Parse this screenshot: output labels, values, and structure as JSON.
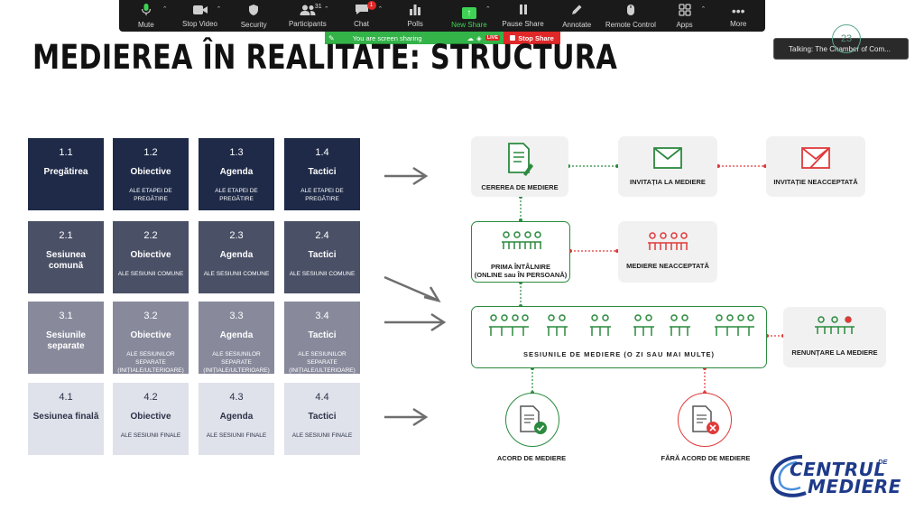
{
  "zoom": {
    "toolbar": [
      {
        "label": "Mute",
        "icon": "microphone-icon"
      },
      {
        "label": "Stop Video",
        "icon": "video-camera-icon"
      },
      {
        "label": "Security",
        "icon": "shield-icon"
      },
      {
        "label": "Participants",
        "icon": "participants-icon",
        "count": "31"
      },
      {
        "label": "Chat",
        "icon": "chat-icon",
        "badge": "1"
      },
      {
        "label": "Polls",
        "icon": "polls-icon"
      },
      {
        "label": "New Share",
        "icon": "share-screen-icon"
      },
      {
        "label": "Pause Share",
        "icon": "pause-icon"
      },
      {
        "label": "Annotate",
        "icon": "pencil-icon"
      },
      {
        "label": "Remote Control",
        "icon": "mouse-icon"
      },
      {
        "label": "Apps",
        "icon": "apps-icon"
      },
      {
        "label": "More",
        "icon": "more-icon"
      }
    ],
    "share_banner": "You are screen sharing",
    "live_badge": "LIVE",
    "stop_share": "Stop Share",
    "talking": "Talking: The Chamber of Com...",
    "accent_color": "#3fd254",
    "stop_color": "#e02828"
  },
  "slide": {
    "number": "23",
    "title": "MEDIEREA ÎN REALITATE: STRUCTURA",
    "grid": [
      [
        {
          "num": "1.1",
          "title": "Pregătirea",
          "sub": ""
        },
        {
          "num": "1.2",
          "title": "Obiective",
          "sub": "ale etapei de pregătire"
        },
        {
          "num": "1.3",
          "title": "Agenda",
          "sub": "ale etapei de pregătire"
        },
        {
          "num": "1.4",
          "title": "Tactici",
          "sub": "ale etapei de pregătire"
        }
      ],
      [
        {
          "num": "2.1",
          "title": "Sesiunea comună",
          "sub": ""
        },
        {
          "num": "2.2",
          "title": "Obiective",
          "sub": "ale sesiunii comune"
        },
        {
          "num": "2.3",
          "title": "Agenda",
          "sub": "ale sesiunii comune"
        },
        {
          "num": "2.4",
          "title": "Tactici",
          "sub": "ale sesiunii comune"
        }
      ],
      [
        {
          "num": "3.1",
          "title": "Sesiunile separate",
          "sub": ""
        },
        {
          "num": "3.2",
          "title": "Obiective",
          "sub": "ale sesiunilor separate (inițiale/ulterioare)"
        },
        {
          "num": "3.3",
          "title": "Agenda",
          "sub": "ale sesiunilor separate (inițiale/ulterioare)"
        },
        {
          "num": "3.4",
          "title": "Tactici",
          "sub": "ale sesiunilor separate (inițiale/ulterioare)"
        }
      ],
      [
        {
          "num": "4.1",
          "title": "Sesiunea finală",
          "sub": ""
        },
        {
          "num": "4.2",
          "title": "Obiective",
          "sub": "ale sesiunii finale"
        },
        {
          "num": "4.3",
          "title": "Agenda",
          "sub": "ale sesiunii finale"
        },
        {
          "num": "4.4",
          "title": "Tactici",
          "sub": "ale sesiunii finale"
        }
      ]
    ],
    "flow": {
      "request": "CEREREA DE MEDIERE",
      "invitation": "INVITAȚIA LA MEDIERE",
      "invitation_refused": "INVITAȚIE NEACCEPTATĂ",
      "first_meeting_l1": "PRIMA ÎNTÂLNIRE",
      "first_meeting_l2": "(ONLINE sau ÎN PERSOANĂ)",
      "mediation_refused": "MEDIERE NEACCEPTATĂ",
      "sessions": "SESIUNILE  DE  MEDIERE (O ZI SAU MAI MULTE)",
      "withdraw": "RENUNȚARE LA MEDIERE",
      "agreement": "ACORD DE MEDIERE",
      "no_agreement": "FĂRĂ ACORD DE MEDIERE",
      "colors": {
        "green": "#2b8a3e",
        "red": "#e03a3a"
      }
    },
    "logo": {
      "line1": "CENTRUL",
      "de": "DE",
      "line2": "MEDIERE"
    }
  }
}
